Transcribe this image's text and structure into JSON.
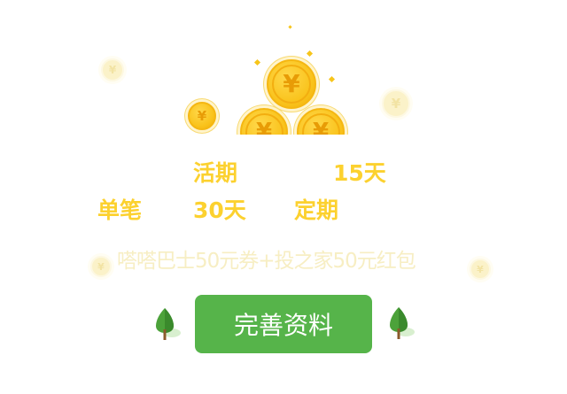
{
  "icons": {
    "coin_symbol": "¥",
    "coin": "coin-icon",
    "tree": "tree-icon"
  },
  "rates": {
    "current_label": "活期",
    "days_15": "15天",
    "single_label": "单笔",
    "days_30": "30天",
    "fixed_label": "定期"
  },
  "reward": {
    "text": "嗒嗒巴士50元券+投之家50元红包"
  },
  "cta": {
    "label": "完善资料"
  },
  "colors": {
    "accent_yellow": "#fcd12f",
    "button_green": "#56b44a",
    "coin_gold": "#f9c21a"
  }
}
